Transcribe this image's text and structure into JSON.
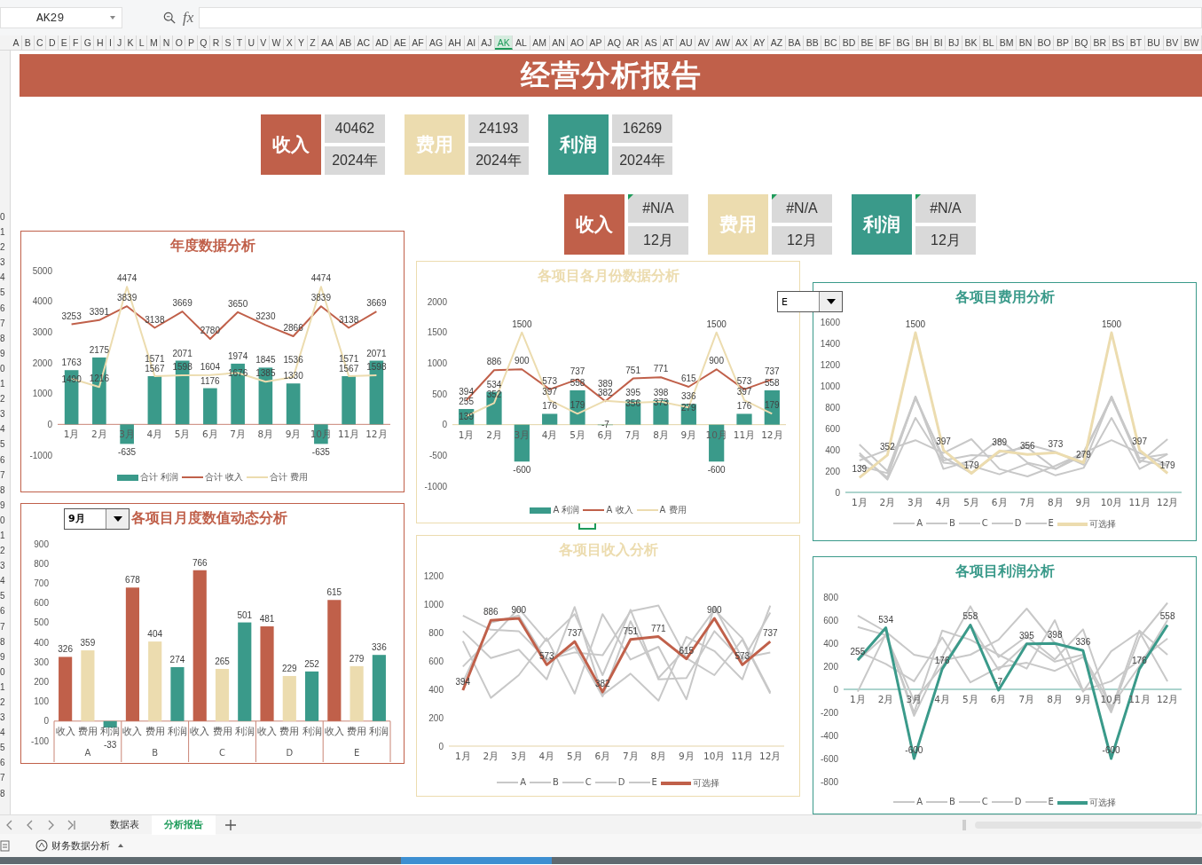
{
  "toolbar": {
    "name_box": "AK29",
    "formula_label": "fx"
  },
  "columns": [
    {
      "label": "A",
      "selected": false
    },
    {
      "label": "B",
      "selected": false
    },
    {
      "label": "C",
      "selected": false
    },
    {
      "label": "D",
      "selected": false
    },
    {
      "label": "E",
      "selected": false
    },
    {
      "label": "F",
      "selected": false
    },
    {
      "label": "G",
      "selected": false
    },
    {
      "label": "H",
      "selected": false
    },
    {
      "label": "I",
      "selected": false
    },
    {
      "label": "J",
      "selected": false
    },
    {
      "label": "K",
      "selected": false
    },
    {
      "label": "L",
      "selected": false
    },
    {
      "label": "M",
      "selected": false
    },
    {
      "label": "N",
      "selected": false
    },
    {
      "label": "O",
      "selected": false
    },
    {
      "label": "P",
      "selected": false
    },
    {
      "label": "Q",
      "selected": false
    },
    {
      "label": "R",
      "selected": false
    },
    {
      "label": "S",
      "selected": false
    },
    {
      "label": "T",
      "selected": false
    },
    {
      "label": "U",
      "selected": false
    },
    {
      "label": "V",
      "selected": false
    },
    {
      "label": "W",
      "selected": false
    },
    {
      "label": "X",
      "selected": false
    },
    {
      "label": "Y",
      "selected": false
    },
    {
      "label": "Z",
      "selected": false
    },
    {
      "label": "AA",
      "selected": false
    },
    {
      "label": "AB",
      "selected": false
    },
    {
      "label": "AC",
      "selected": false
    },
    {
      "label": "AD",
      "selected": false
    },
    {
      "label": "AE",
      "selected": false
    },
    {
      "label": "AF",
      "selected": false
    },
    {
      "label": "AG",
      "selected": false
    },
    {
      "label": "AH",
      "selected": false
    },
    {
      "label": "AI",
      "selected": false
    },
    {
      "label": "AJ",
      "selected": false
    },
    {
      "label": "AK",
      "selected": true
    },
    {
      "label": "AL",
      "selected": false
    },
    {
      "label": "AM",
      "selected": false
    },
    {
      "label": "AN",
      "selected": false
    },
    {
      "label": "AO",
      "selected": false
    },
    {
      "label": "AP",
      "selected": false
    },
    {
      "label": "AQ",
      "selected": false
    },
    {
      "label": "AR",
      "selected": false
    },
    {
      "label": "AS",
      "selected": false
    },
    {
      "label": "AT",
      "selected": false
    },
    {
      "label": "AU",
      "selected": false
    },
    {
      "label": "AV",
      "selected": false
    },
    {
      "label": "AW",
      "selected": false
    },
    {
      "label": "AX",
      "selected": false
    },
    {
      "label": "AY",
      "selected": false
    },
    {
      "label": "AZ",
      "selected": false
    },
    {
      "label": "BA",
      "selected": false
    },
    {
      "label": "BB",
      "selected": false
    },
    {
      "label": "BC",
      "selected": false
    },
    {
      "label": "BD",
      "selected": false
    },
    {
      "label": "BE",
      "selected": false
    },
    {
      "label": "BF",
      "selected": false
    },
    {
      "label": "BG",
      "selected": false
    },
    {
      "label": "BH",
      "selected": false
    },
    {
      "label": "BI",
      "selected": false
    },
    {
      "label": "BJ",
      "selected": false
    },
    {
      "label": "BK",
      "selected": false
    },
    {
      "label": "BL",
      "selected": false
    },
    {
      "label": "BM",
      "selected": false
    },
    {
      "label": "BN",
      "selected": false
    },
    {
      "label": "BO",
      "selected": false
    },
    {
      "label": "BP",
      "selected": false
    },
    {
      "label": "BQ",
      "selected": false
    },
    {
      "label": "BR",
      "selected": false
    },
    {
      "label": "BS",
      "selected": false
    },
    {
      "label": "BT",
      "selected": false
    },
    {
      "label": "BU",
      "selected": false
    },
    {
      "label": "BV",
      "selected": false
    },
    {
      "label": "BW",
      "selected": false
    }
  ],
  "row_numbers": [
    "0",
    "1",
    "2",
    "3",
    "4",
    "5",
    "6",
    "7",
    "8",
    "9",
    "0",
    "1",
    "2",
    "3",
    "4",
    "5",
    "6",
    "7",
    "8",
    "9",
    "0",
    "1",
    "2",
    "3",
    "4",
    "5",
    "6",
    "7",
    "8",
    "9",
    "0",
    "1",
    "2",
    "3",
    "4",
    "5",
    "6",
    "7",
    "8"
  ],
  "report": {
    "title": "经营分析报告",
    "kpi_rows": [
      [
        {
          "label": "收入",
          "value": "40462",
          "period": "2024年",
          "color": "#c0604a",
          "flagged": false
        },
        {
          "label": "费用",
          "value": "24193",
          "period": "2024年",
          "color": "#ecdcaf",
          "flagged": false
        },
        {
          "label": "利润",
          "value": "16269",
          "period": "2024年",
          "color": "#3a9a8a",
          "flagged": false
        }
      ],
      [
        {
          "label": "收入",
          "value": "#N/A",
          "period": "12月",
          "color": "#c0604a",
          "flagged": true
        },
        {
          "label": "费用",
          "value": "#N/A",
          "period": "12月",
          "color": "#ecdcaf",
          "flagged": true
        },
        {
          "label": "利润",
          "value": "#N/A",
          "period": "12月",
          "color": "#3a9a8a",
          "flagged": true
        }
      ]
    ],
    "item_selector": {
      "value": "E"
    },
    "charts": [
      {
        "color": "#c0604a",
        "chart_data": {
          "type": "bar",
          "title": "年度数据分析",
          "categories": [
            "1月",
            "2月",
            "3月",
            "4月",
            "5月",
            "6月",
            "7月",
            "8月",
            "9月",
            "10月",
            "11月",
            "12月"
          ],
          "ylim": [
            -1000,
            5000
          ],
          "yticks": [
            -1000,
            0,
            1000,
            2000,
            3000,
            4000,
            5000
          ],
          "data_labels": true,
          "legend": true,
          "series": [
            {
              "name": "合计 利润",
              "type": "bar",
              "color": "#3a9a8a",
              "data_labels": true,
              "values": [
                1763,
                2175,
                -635,
                1567,
                2071,
                1176,
                1974,
                1845,
                1330,
                -635,
                1567,
                2071
              ]
            },
            {
              "name": "合计 收入",
              "type": "line",
              "color": "#c0604a",
              "data_labels": true,
              "values": [
                3253,
                3391,
                3839,
                3138,
                3669,
                2780,
                3650,
                3230,
                2866,
                3839,
                3138,
                3669
              ]
            },
            {
              "name": "合计 费用",
              "type": "line",
              "color": "#ecdcaf",
              "data_labels": true,
              "values": [
                1490,
                1216,
                4474,
                1571,
                1598,
                1604,
                1676,
                1385,
                1536,
                4474,
                1571,
                1598
              ]
            }
          ]
        }
      },
      {
        "color": "#c0604a",
        "month_selector": {
          "value": "9月"
        },
        "groups": [
          "A",
          "B",
          "C",
          "D",
          "E"
        ],
        "chart_data": {
          "type": "bar",
          "title": "各项目月度数值动态分析",
          "categories": [
            "收入",
            "费用",
            "利润",
            "收入",
            "费用",
            "利润",
            "收入",
            "费用",
            "利润",
            "收入",
            "费用",
            "利润",
            "收入",
            "费用",
            "利润"
          ],
          "ylim": [
            -100,
            900
          ],
          "yticks": [
            -100,
            0,
            100,
            200,
            300,
            400,
            500,
            600,
            700,
            800,
            900
          ],
          "data_labels": true,
          "series": [
            {
              "color": "#c0604a",
              "data_labels": true,
              "values": [
                326,
                null,
                null,
                678,
                null,
                null,
                766,
                null,
                null,
                481,
                null,
                null,
                615,
                null,
                null
              ]
            },
            {
              "color": "#ecdcaf",
              "data_labels": true,
              "values": [
                null,
                359,
                null,
                null,
                404,
                null,
                null,
                265,
                null,
                null,
                229,
                null,
                null,
                279,
                null
              ]
            },
            {
              "color": "#3a9a8a",
              "data_labels": true,
              "values": [
                null,
                null,
                -33,
                null,
                null,
                274,
                null,
                null,
                501,
                null,
                null,
                252,
                null,
                null,
                336
              ]
            }
          ]
        }
      },
      {
        "color": "#ecdcaf",
        "chart_data": {
          "type": "bar",
          "title": "各项目各月份数据分析",
          "categories": [
            "1月",
            "2月",
            "3月",
            "4月",
            "5月",
            "6月",
            "7月",
            "8月",
            "9月",
            "10月",
            "11月",
            "12月"
          ],
          "ylim": [
            -1000,
            2000
          ],
          "yticks": [
            -1000,
            -500,
            0,
            500,
            1000,
            1500,
            2000
          ],
          "data_labels": true,
          "legend": true,
          "series": [
            {
              "name": "A 利润",
              "type": "bar",
              "color": "#3a9a8a",
              "data_labels": true,
              "values": [
                255,
                534,
                -600,
                176,
                558,
                -7,
                395,
                398,
                336,
                -600,
                176,
                558
              ]
            },
            {
              "name": "A 收入",
              "type": "line",
              "color": "#c0604a",
              "data_labels": true,
              "values": [
                394,
                886,
                900,
                573,
                737,
                382,
                751,
                771,
                615,
                900,
                573,
                737
              ]
            },
            {
              "name": "A 费用",
              "type": "line",
              "color": "#ecdcaf",
              "data_labels": true,
              "values": [
                139,
                352,
                1500,
                397,
                179,
                389,
                356,
                373,
                279,
                1500,
                397,
                179
              ]
            }
          ]
        }
      },
      {
        "color": "#ecdcaf",
        "chart_data": {
          "type": "line",
          "title": "各项目收入分析",
          "categories": [
            "1月",
            "2月",
            "3月",
            "4月",
            "5月",
            "6月",
            "7月",
            "8月",
            "9月",
            "10月",
            "11月",
            "12月"
          ],
          "ylim": [
            0,
            1200
          ],
          "yticks": [
            0,
            200,
            400,
            600,
            800,
            1000,
            1200
          ],
          "data_labels": true,
          "legend": true,
          "series": [
            {
              "name": "A",
              "type": "line",
              "color": "#c8c8c8",
              "data_labels": false,
              "values": [
                920,
                820,
                810,
                610,
                660,
                640,
                950,
                990,
                620,
                500,
                750,
                370
              ]
            },
            {
              "name": "B",
              "type": "line",
              "color": "#c8c8c8",
              "data_labels": false,
              "values": [
                810,
                620,
                680,
                470,
                980,
                360,
                510,
                320,
                770,
                670,
                470,
                990
              ]
            },
            {
              "name": "C",
              "type": "line",
              "color": "#c8c8c8",
              "data_labels": false,
              "values": [
                740,
                340,
                500,
                760,
                370,
                930,
                610,
                700,
                330,
                980,
                620,
                660
              ]
            },
            {
              "name": "D",
              "type": "line",
              "color": "#c8c8c8",
              "data_labels": false,
              "values": [
                560,
                760,
                970,
                740,
                930,
                500,
                960,
                470,
                480,
                810,
                600,
                940
              ]
            },
            {
              "name": "E",
              "type": "line",
              "color": "#c8c8c8",
              "data_labels": false,
              "values": [
                450,
                870,
                920,
                600,
                700,
                350,
                880,
                480,
                690,
                960,
                760,
                380
              ]
            },
            {
              "name": "可选择",
              "type": "line",
              "color": "#c0604a",
              "data_labels": true,
              "values": [
                394,
                886,
                900,
                573,
                737,
                382,
                751,
                771,
                615,
                900,
                573,
                737
              ]
            }
          ]
        }
      },
      {
        "color": "#3a9a8a",
        "chart_data": {
          "type": "line",
          "title": "各项目费用分析",
          "categories": [
            "1月",
            "2月",
            "3月",
            "4月",
            "5月",
            "6月",
            "7月",
            "8月",
            "9月",
            "10月",
            "11月",
            "12月"
          ],
          "ylim": [
            0,
            1600
          ],
          "yticks": [
            0,
            200,
            400,
            600,
            800,
            1000,
            1200,
            1400,
            1600
          ],
          "data_labels": true,
          "legend": true,
          "series": [
            {
              "name": "A",
              "type": "line",
              "color": "#c8c8c8",
              "data_labels": false,
              "values": [
                450,
                200,
                900,
                300,
                350,
                340,
                450,
                380,
                260,
                900,
                280,
                500
              ]
            },
            {
              "name": "B",
              "type": "line",
              "color": "#c8c8c8",
              "data_labels": false,
              "values": [
                370,
                120,
                700,
                280,
                250,
                170,
                270,
                160,
                230,
                700,
                220,
                360
              ]
            },
            {
              "name": "C",
              "type": "line",
              "color": "#c8c8c8",
              "data_labels": false,
              "values": [
                300,
                400,
                490,
                370,
                500,
                220,
                150,
                250,
                370,
                490,
                370,
                260
              ]
            },
            {
              "name": "D",
              "type": "line",
              "color": "#c8c8c8",
              "data_labels": false,
              "values": [
                350,
                140,
                900,
                220,
                300,
                500,
                280,
                220,
                350,
                900,
                320,
                360
              ]
            },
            {
              "name": "E",
              "type": "line",
              "color": "#c8c8c8",
              "data_labels": false,
              "values": [
                250,
                180,
                880,
                330,
                180,
                380,
                420,
                220,
                380,
                880,
                300,
                250
              ]
            },
            {
              "name": "可选择",
              "type": "line",
              "color": "#ecdcaf",
              "data_labels": true,
              "values": [
                139,
                352,
                1500,
                397,
                179,
                389,
                356,
                373,
                279,
                1500,
                397,
                179
              ]
            }
          ]
        }
      },
      {
        "color": "#3a9a8a",
        "chart_data": {
          "type": "line",
          "title": "各项目利润分析",
          "categories": [
            "1月",
            "2月",
            "3月",
            "4月",
            "5月",
            "6月",
            "7月",
            "8月",
            "9月",
            "10月",
            "11月",
            "12月"
          ],
          "ylim": [
            -800,
            800
          ],
          "yticks": [
            -800,
            -600,
            -400,
            -200,
            0,
            200,
            400,
            600,
            800
          ],
          "data_labels": true,
          "legend": true,
          "series": [
            {
              "name": "A",
              "type": "line",
              "color": "#c8c8c8",
              "data_labels": false,
              "values": [
                640,
                500,
                300,
                250,
                300,
                430,
                700,
                400,
                -20,
                330,
                500,
                70
              ]
            },
            {
              "name": "B",
              "type": "line",
              "color": "#c8c8c8",
              "data_labels": false,
              "values": [
                540,
                470,
                -200,
                510,
                430,
                300,
                180,
                600,
                -10,
                70,
                250,
                440
              ]
            },
            {
              "name": "C",
              "type": "line",
              "color": "#c8c8c8",
              "data_labels": false,
              "values": [
                330,
                220,
                70,
                450,
                60,
                190,
                230,
                160,
                280,
                -200,
                450,
                750
              ]
            },
            {
              "name": "D",
              "type": "line",
              "color": "#c8c8c8",
              "data_labels": false,
              "values": [
                -20,
                480,
                -230,
                280,
                720,
                280,
                460,
                260,
                520,
                -180,
                510,
                300
              ]
            },
            {
              "name": "E",
              "type": "line",
              "color": "#c8c8c8",
              "data_labels": false,
              "values": [
                250,
                470,
                -100,
                200,
                560,
                170,
                400,
                240,
                300,
                -150,
                200,
                600
              ]
            },
            {
              "name": "可选择",
              "type": "line",
              "color": "#3a9a8a",
              "data_labels": true,
              "values": [
                255,
                534,
                -600,
                176,
                558,
                -7,
                395,
                398,
                336,
                -600,
                176,
                558
              ]
            }
          ]
        }
      }
    ]
  },
  "sheet_tabs": [
    {
      "label": "数据表",
      "selected": false
    },
    {
      "label": "分析报告",
      "selected": true
    }
  ],
  "status_bar": {
    "workbook": "财务数据分析"
  }
}
